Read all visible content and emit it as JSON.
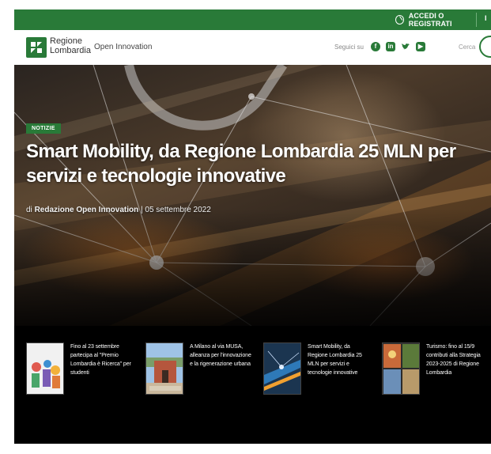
{
  "topbar": {
    "login_label": "ACCEDI O REGISTRATI",
    "extra_label": "I"
  },
  "header": {
    "logo_line1": "Regione",
    "logo_line2": "Lombardia",
    "nav_item": "Open Innovation",
    "follow_label": "Seguici su",
    "search_label": "Cerca",
    "social_icons": [
      "facebook-icon",
      "linkedin-icon",
      "twitter-icon",
      "youtube-icon"
    ]
  },
  "hero": {
    "tag": "NOTIZIE",
    "title": "Smart Mobility, da Regione Lombardia 25 MLN per servizi e tecnologie innovative",
    "meta_prefix": "di ",
    "author": "Redazione Open Innovation",
    "meta_sep": " | ",
    "date": "05 settembre 2022"
  },
  "cards": [
    {
      "text": "Fino al 23 settembre partecipa al \"Premio Lombardia è Ricerca\" per studenti"
    },
    {
      "text": "A Milano al via MUSA, alleanza per l'innovazione e la rigenerazione urbana"
    },
    {
      "text": "Smart Mobility, da Regione Lombardia 25 MLN per servizi e tecnologie innovative"
    },
    {
      "text": "Turismo: fino al 15/9 contributi alla Strategia 2023-2025 di Regione Lombardia"
    }
  ],
  "colors": {
    "brand_green": "#297a38",
    "background": "#000000"
  }
}
